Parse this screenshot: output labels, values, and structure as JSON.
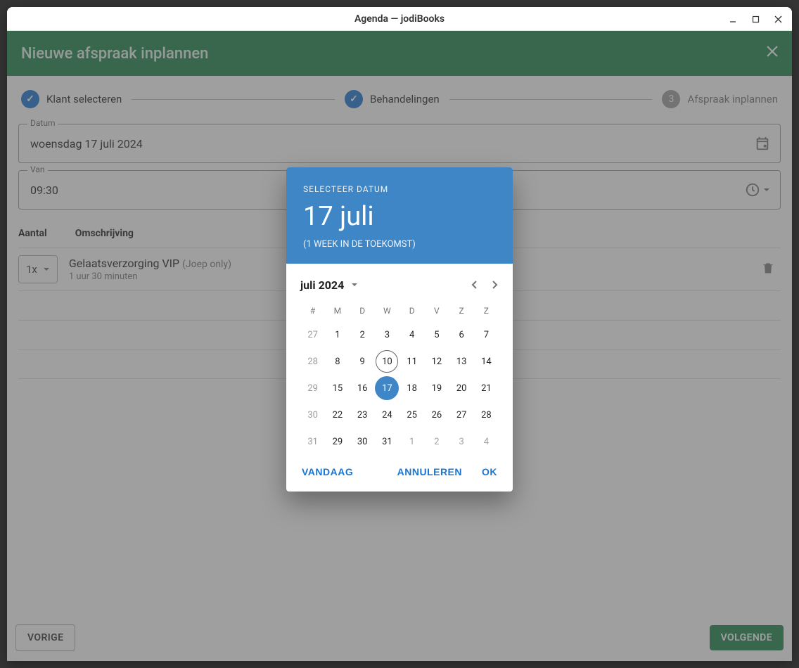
{
  "window": {
    "title": "Agenda — jodiBooks"
  },
  "header": {
    "title": "Nieuwe afspraak inplannen"
  },
  "stepper": {
    "step1": "Klant selecteren",
    "step2": "Behandelingen",
    "step3": "Afspraak inplannen",
    "step3_num": "3"
  },
  "fields": {
    "date_label": "Datum",
    "date_value": "woensdag 17 juli 2024",
    "time_label": "Van",
    "time_value": "09:30"
  },
  "list": {
    "head_qty": "Aantal",
    "head_desc": "Omschrijving",
    "item_qty": "1x",
    "item_title": "Gelaatsverzorging VIP",
    "item_sub": "(Joep only)",
    "item_duration": "1 uur 30 minuten"
  },
  "footer": {
    "prev": "VORIGE",
    "next": "VOLGENDE"
  },
  "datepicker": {
    "label": "SELECTEER DATUM",
    "big": "17 juli",
    "meta": "(1 WEEK IN DE TOEKOMST)",
    "month": "juli 2024",
    "dow": [
      "#",
      "M",
      "D",
      "W",
      "D",
      "V",
      "Z",
      "Z"
    ],
    "weeks": [
      {
        "wk": "27",
        "days": [
          {
            "d": "1"
          },
          {
            "d": "2"
          },
          {
            "d": "3"
          },
          {
            "d": "4"
          },
          {
            "d": "5"
          },
          {
            "d": "6"
          },
          {
            "d": "7"
          }
        ]
      },
      {
        "wk": "28",
        "days": [
          {
            "d": "8"
          },
          {
            "d": "9"
          },
          {
            "d": "10",
            "today": true
          },
          {
            "d": "11"
          },
          {
            "d": "12"
          },
          {
            "d": "13"
          },
          {
            "d": "14"
          }
        ]
      },
      {
        "wk": "29",
        "days": [
          {
            "d": "15"
          },
          {
            "d": "16"
          },
          {
            "d": "17",
            "selected": true
          },
          {
            "d": "18"
          },
          {
            "d": "19"
          },
          {
            "d": "20"
          },
          {
            "d": "21"
          }
        ]
      },
      {
        "wk": "30",
        "days": [
          {
            "d": "22"
          },
          {
            "d": "23"
          },
          {
            "d": "24"
          },
          {
            "d": "25"
          },
          {
            "d": "26"
          },
          {
            "d": "27"
          },
          {
            "d": "28"
          }
        ]
      },
      {
        "wk": "31",
        "days": [
          {
            "d": "29"
          },
          {
            "d": "30"
          },
          {
            "d": "31"
          },
          {
            "d": "1",
            "out": true
          },
          {
            "d": "2",
            "out": true
          },
          {
            "d": "3",
            "out": true
          },
          {
            "d": "4",
            "out": true
          }
        ]
      }
    ],
    "today": "VANDAAG",
    "cancel": "ANNULEREN",
    "ok": "OK"
  }
}
